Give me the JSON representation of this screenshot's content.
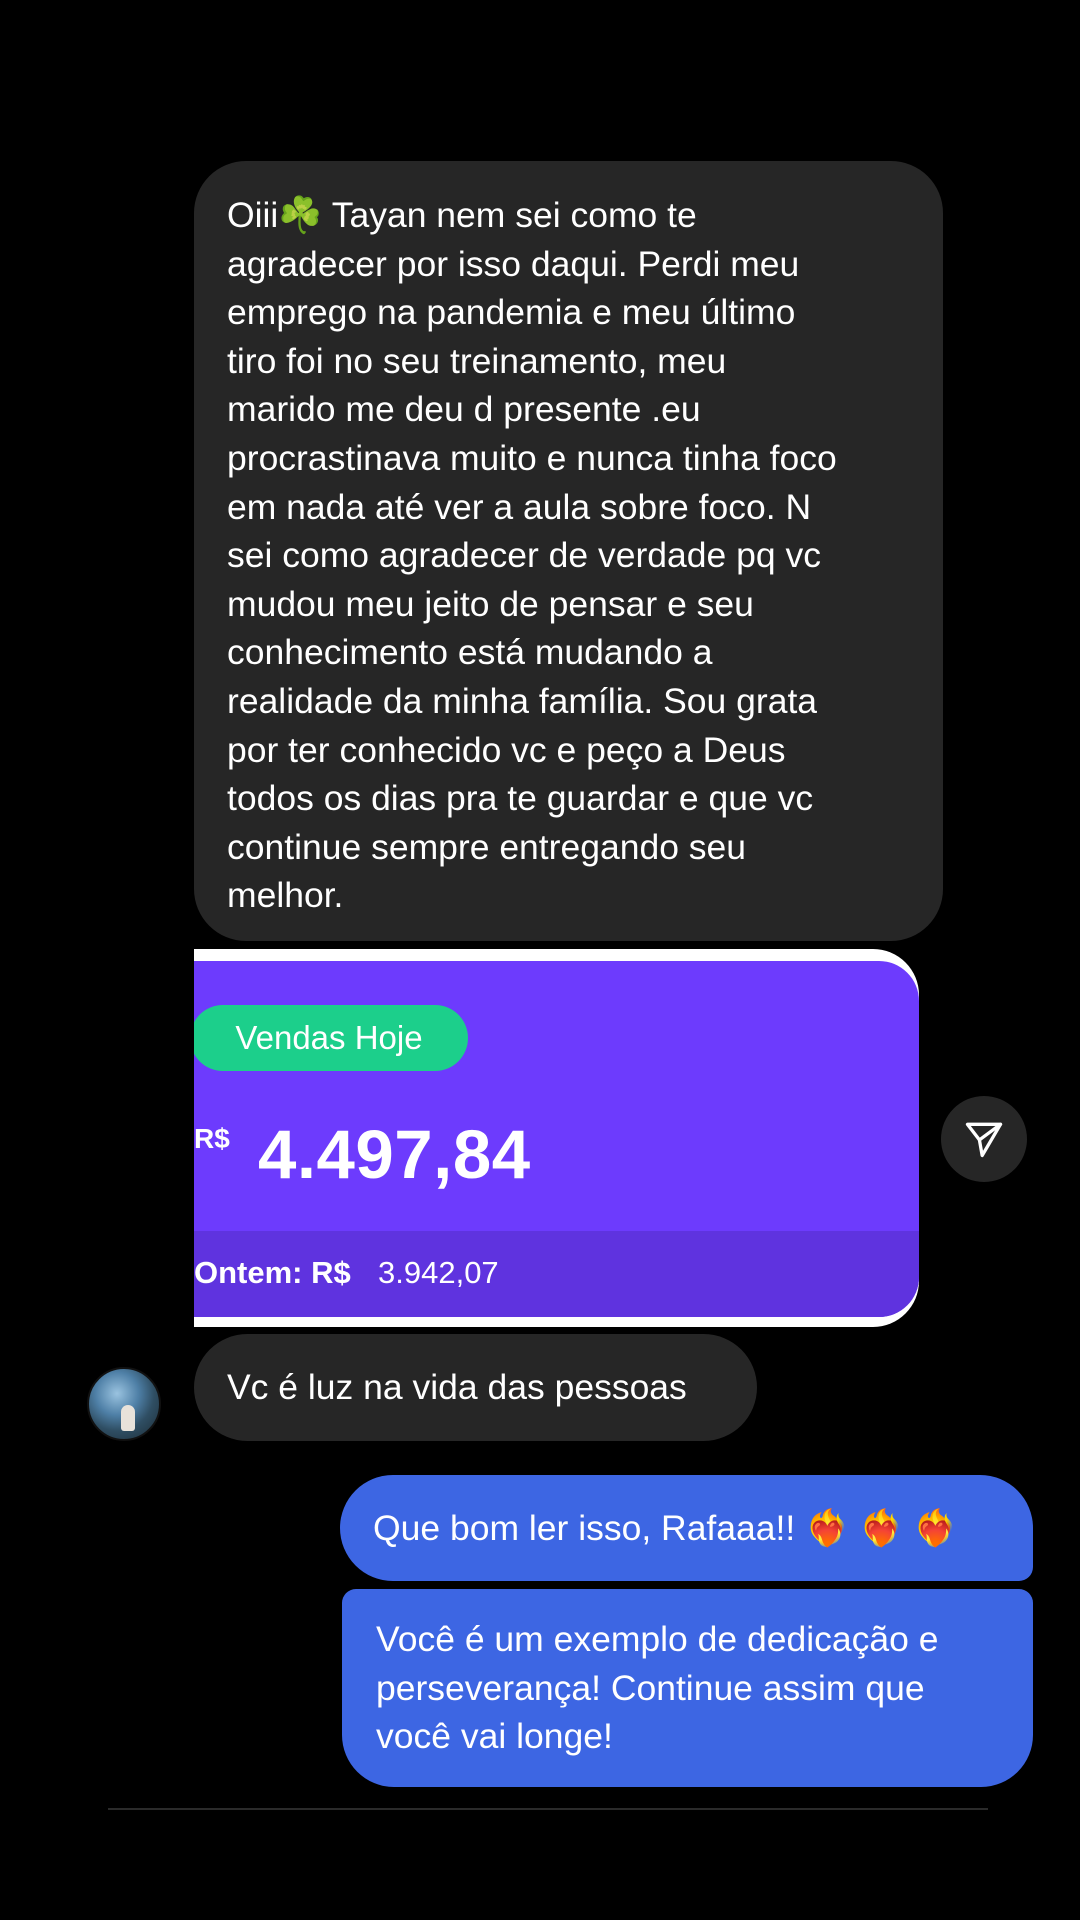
{
  "messages": {
    "received_1": {
      "prefix": "Oiii",
      "emoji": "☘️",
      "text": " Tayan nem sei como te\nagradecer por isso daqui. Perdi meu\nemprego na pandemia e meu último\ntiro foi no seu treinamento, meu\nmarido me deu d  presente .eu\nprocrastinava muito e nunca tinha foco\nem nada até ver a aula sobre foco. N\nsei como agradecer de verdade pq vc\nmudou meu jeito de pensar e seu\nconhecimento está mudando a\nrealidade da minha família. Sou grata\npor ter conhecido vc e peço a Deus\ntodos os dias pra te guardar e que vc\ncontinue sempre entregando seu\nmelhor."
    },
    "sales_card": {
      "pill_label": "Vendas Hoje",
      "currency": "R$",
      "amount": "4.497,84",
      "yesterday_label": "Ontem: R$",
      "yesterday_value": "3.942,07"
    },
    "received_2": {
      "text": "Vc é luz na vida das pessoas"
    },
    "sent_1": {
      "text": "Que bom ler isso, Rafaaa!! ❤️‍🔥 ❤️‍🔥 ❤️‍🔥"
    },
    "sent_2": {
      "text": "Você é um exemplo de dedicação e\nperseverança! Continue assim que\nvocê vai longe!"
    }
  },
  "icons": {
    "share": "paper-plane-icon",
    "avatar": "profile-avatar"
  },
  "colors": {
    "received_bubble": "#262626",
    "sent_bubble": "#3d66e3",
    "card_purple": "#6d3bfd",
    "card_green": "#1ccf8b"
  }
}
